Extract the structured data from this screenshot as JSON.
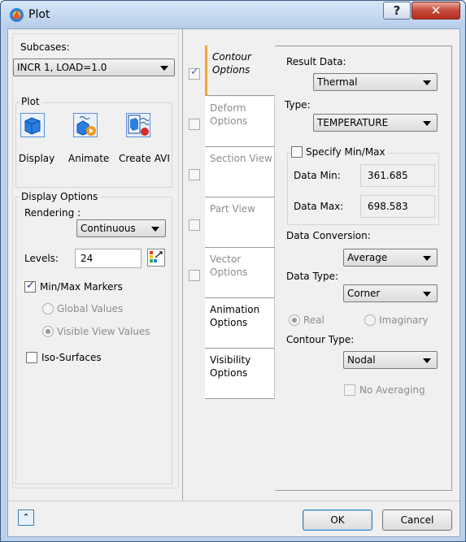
{
  "window": {
    "title": "Plot",
    "help_label": "?",
    "close_label": "✕"
  },
  "subcases": {
    "label": "Subcases:",
    "value": "INCR 1, LOAD=1.0"
  },
  "plot": {
    "label": "Plot",
    "display_label": "Display",
    "animate_label": "Animate",
    "create_avi_label": "Create AVI"
  },
  "display_options": {
    "label": "Display Options",
    "rendering_label": "Rendering :",
    "rendering_value": "Continuous",
    "levels_label": "Levels:",
    "levels_value": "24",
    "minmax_markers_label": "Min/Max Markers",
    "global_values_label": "Global Values",
    "visible_view_values_label": "Visible View Values",
    "iso_surfaces_label": "Iso-Surfaces"
  },
  "tabs": [
    {
      "label": "Contour Options"
    },
    {
      "label": "Deform Options"
    },
    {
      "label": "Section View"
    },
    {
      "label": "Part View"
    },
    {
      "label": "Vector Options"
    },
    {
      "label": "Animation Options"
    },
    {
      "label": "Visibility Options"
    }
  ],
  "contour": {
    "result_data_label": "Result Data:",
    "result_data_value": "Thermal",
    "type_label": "Type:",
    "type_value": "TEMPERATURE",
    "specify_minmax_label": "Specify Min/Max",
    "data_min_label": "Data Min:",
    "data_min_value": "361.685",
    "data_max_label": "Data Max:",
    "data_max_value": "698.583",
    "data_conversion_label": "Data Conversion:",
    "data_conversion_value": "Average",
    "data_type_label": "Data Type:",
    "data_type_value": "Corner",
    "real_label": "Real",
    "imaginary_label": "Imaginary",
    "contour_type_label": "Contour Type:",
    "contour_type_value": "Nodal",
    "no_averaging_label": "No Averaging"
  },
  "footer": {
    "expand_label": "⌃",
    "ok_label": "OK",
    "cancel_label": "Cancel"
  }
}
